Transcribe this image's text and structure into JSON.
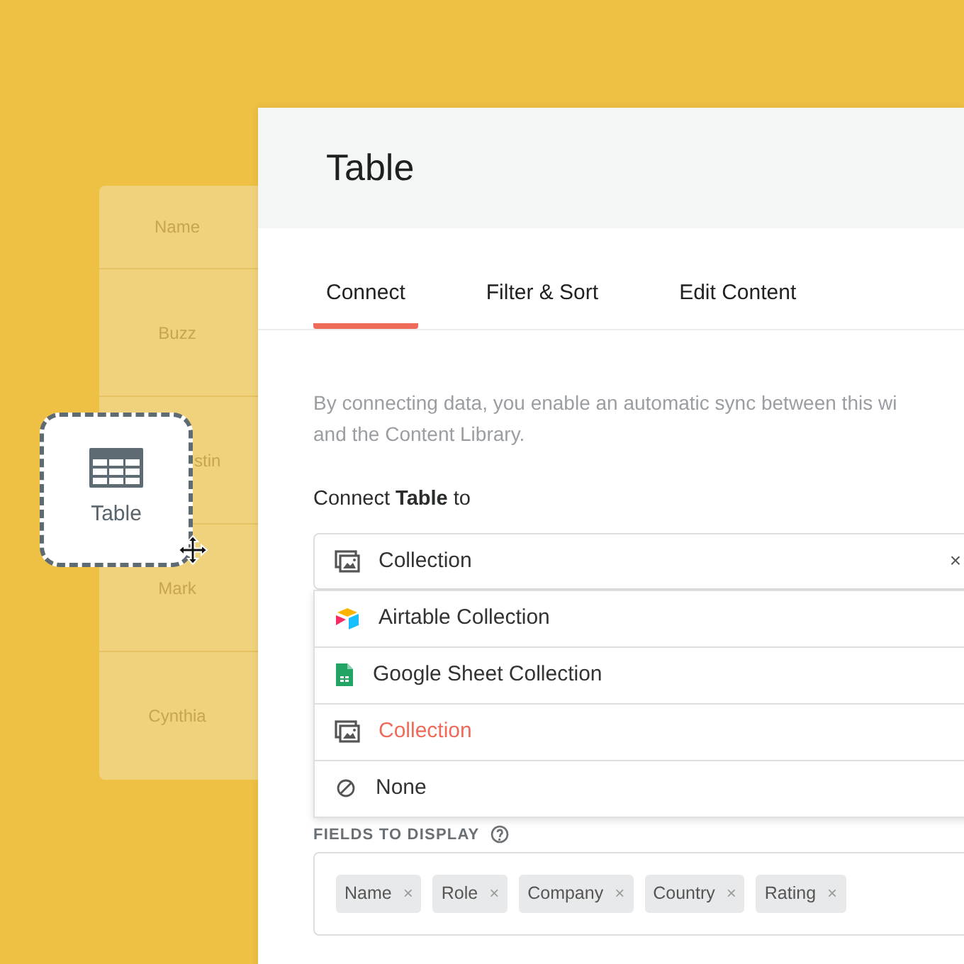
{
  "background_table": {
    "cells": [
      {
        "kind": "header",
        "text": "Name"
      },
      {
        "kind": "row",
        "text": "Buzz"
      },
      {
        "kind": "covered",
        "text": "stin"
      },
      {
        "kind": "row",
        "text": "Mark"
      },
      {
        "kind": "row",
        "text": "Cynthia"
      }
    ]
  },
  "drag_card": {
    "label": "Table"
  },
  "panel": {
    "title": "Table",
    "tabs": [
      {
        "label": "Connect",
        "selected": true
      },
      {
        "label": "Filter & Sort",
        "selected": false
      },
      {
        "label": "Edit Content",
        "selected": false
      }
    ],
    "description_lines": [
      "By connecting data, you enable an automatic sync between this wi",
      "and the Content Library."
    ],
    "connect_label": "Connect **Table** to",
    "select": {
      "kind": "collection",
      "value": "Collection",
      "clear": "×"
    },
    "options": [
      {
        "kind": "airtable",
        "label": "Airtable Collection",
        "selected": false
      },
      {
        "kind": "sheet",
        "label": "Google Sheet Collection",
        "selected": false
      },
      {
        "kind": "collection",
        "label": "Collection",
        "selected": true
      },
      {
        "kind": "none",
        "label": "None",
        "selected": false
      }
    ],
    "fields_label": "FIELDS TO DISPLAY",
    "fields": [
      {
        "label": "Name",
        "remove": "×"
      },
      {
        "label": "Role",
        "remove": "×"
      },
      {
        "label": "Company",
        "remove": "×"
      },
      {
        "label": "Country",
        "remove": "×"
      },
      {
        "label": "Rating",
        "remove": "×"
      }
    ]
  }
}
